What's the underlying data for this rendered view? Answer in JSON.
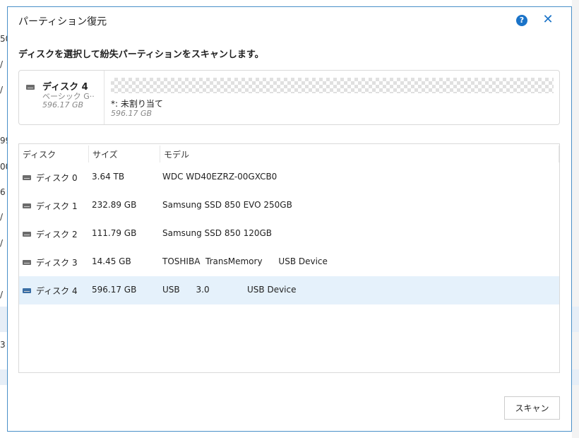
{
  "background": {
    "fragments": [
      "50",
      "/",
      "/",
      "99",
      "00",
      "6",
      "/",
      "/",
      "/",
      "3 /"
    ]
  },
  "dialog": {
    "title": "パーティション復元",
    "help_glyph": "?",
    "close_glyph": "✕",
    "instruction": "ディスクを選択して紛失パーティションをスキャンします。"
  },
  "disk_panel": {
    "name": "ディスク 4",
    "type": "ベーシック G··",
    "size": "596.17 GB",
    "partition_label": "*: 未割り当て",
    "partition_size": "596.17 GB"
  },
  "table": {
    "headers": [
      "ディスク",
      "サイズ",
      "モデル"
    ],
    "rows": [
      {
        "disk": "ディスク 0",
        "size": "3.64 TB",
        "model": "WDC WD40EZRZ-00GXCB0",
        "icon": "hdd-icon"
      },
      {
        "disk": "ディスク 1",
        "size": "232.89 GB",
        "model": "Samsung SSD 850 EVO 250GB",
        "icon": "hdd-icon"
      },
      {
        "disk": "ディスク 2",
        "size": "111.79 GB",
        "model": "Samsung SSD 850 120GB",
        "icon": "hdd-icon"
      },
      {
        "disk": "ディスク 3",
        "size": "14.45 GB",
        "model": "TOSHIBA  TransMemory      USB Device",
        "icon": "hdd-icon"
      },
      {
        "disk": "ディスク 4",
        "size": "596.17 GB",
        "model": "USB      3.0              USB Device",
        "icon": "usb-hdd-icon",
        "selected": true
      }
    ]
  },
  "buttons": {
    "scan": "スキャン"
  },
  "colors": {
    "accent": "#1a73c8",
    "border": "#4a90c8",
    "selected_row": "#e5f1fb"
  }
}
